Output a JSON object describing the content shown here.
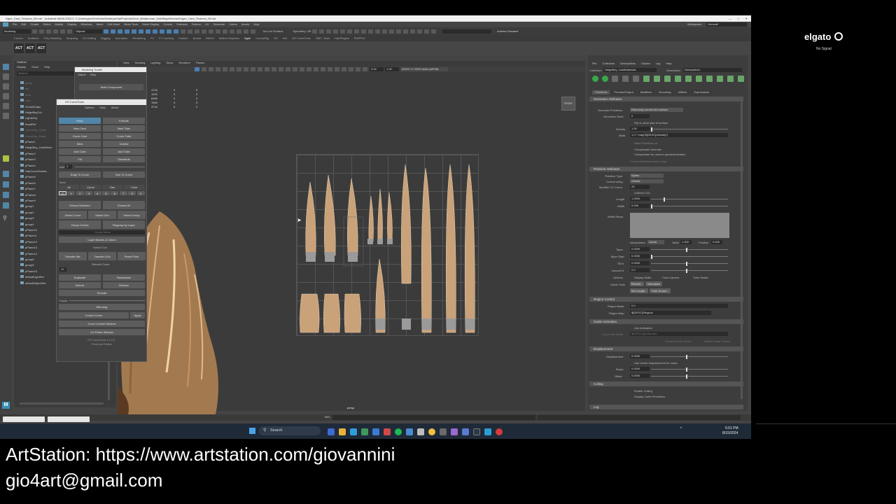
{
  "window": {
    "title": "Xgen_Card_Textures_05.ma* - Autodesk MAYA 2024.2: C:\\Users\\gior\\OneDrive\\Desktop\\HairProjects\\Zone_Metahuman_Hair\\Maya\\Scenes\\Xgen_Card_Textures_05.ma",
    "workspace_label": "Workspace:",
    "workspace_value": "General*"
  },
  "menubar": [
    "File",
    "Edit",
    "Create",
    "Select",
    "Modify",
    "Display",
    "Windows",
    "Mesh",
    "Edit Mesh",
    "Mesh Tools",
    "Mesh Display",
    "Curves",
    "Surfaces",
    "Deform",
    "UV",
    "Generate",
    "Cache",
    "Arnold",
    "Help"
  ],
  "statusline": {
    "mode": "Modeling",
    "objects": "Objects",
    "live_surface": "No Live Surface",
    "symmetry": "Symmetry: Off",
    "user": "Andrew Giovanni"
  },
  "shelf_tabs": [
    "Curves",
    "Surfaces",
    "Poly Modeling",
    "Sculpting",
    "UV Editing",
    "Rigging",
    "Animation",
    "Rendering",
    "FX",
    "FX Caching",
    "Custom",
    "Arnold",
    "MASH",
    "Motion Graphics",
    "Xgen",
    "CurveyRig",
    "GS",
    "Hot",
    "GS CurveTools",
    "GMT_Tools",
    "HairPlugins",
    "PURPLE"
  ],
  "outliner": {
    "title": "Outliner",
    "menu": [
      "Display",
      "Show",
      "Help"
    ],
    "search": "Search...",
    "items": [
      "persp",
      "top",
      "front",
      "side",
      "GrowthCaps",
      "HelgeBeyCut",
      "LightsGrp",
      "headRef",
      "CurveGrp_Guide",
      "CurveGrp_Scalp",
      "pPlane1",
      "HelgeBey_CardMesh",
      "pPlane2",
      "pPlane3",
      "pPlane4",
      "HairCurveGuides",
      "pPlane5",
      "pPlane6",
      "pPlane7",
      "pPlane8",
      "pPlane9",
      "group1",
      "group2",
      "group3",
      "group4",
      "pPlane10",
      "pPlane11",
      "pPlane12",
      "pPlane13",
      "pPlane14",
      "group5",
      "group6",
      "pPlane15",
      "defaultLightSet",
      "defaultObjectSet"
    ]
  },
  "modeling_toolkit": {
    "title": "Modeling Toolkit",
    "menu": [
      "Object",
      "Help"
    ],
    "multi_component": "Multi-Component",
    "stats": [
      [
        "4716",
        "0",
        "0"
      ],
      [
        "1193",
        "0",
        "0"
      ],
      [
        "6490",
        "0",
        "0"
      ],
      [
        "7840",
        "0",
        "0"
      ],
      [
        "4716",
        "0",
        "0"
      ]
    ]
  },
  "gs_curvetools": {
    "title": "GS CurveTools",
    "menu": [
      "Options",
      "Help",
      "About"
    ],
    "buttons": [
      [
        "Warp",
        "Extrude"
      ],
      [
        "New Card",
        "New Tube"
      ],
      [
        "Curve Card",
        "Curve Tube"
      ],
      [
        "Bind",
        "Unbind"
      ],
      [
        "Add Card",
        "Add Tube"
      ],
      [
        "Fill",
        "Subdivide"
      ]
    ],
    "add_label": "Add",
    "add_value": "3",
    "edge_to_curve": "Edge To Curve",
    "geo_to_curve": "Geo To Curve",
    "more": "More",
    "filters": [
      "All",
      "Curve",
      "Geo",
      "Color"
    ],
    "digits": [
      "0",
      "1",
      "2",
      "3",
      "4",
      "5",
      "6",
      "7",
      "8",
      "9"
    ],
    "extract_selected": "Extract Selected",
    "extract_all": "Extract All",
    "select_curve": "Select Curve",
    "select_geo": "Select Geo",
    "select_group": "Select Group",
    "group_curves": "Group Curves",
    "regroup_by_layer": "Regroup by Layer",
    "group_name": "Group Name",
    "layer_names_colors": "Layer Names & Colors",
    "select_cvs": "Select CVs",
    "transfer_attr": "Transfer Attr.",
    "transfer_uvs": "Transfer UVs",
    "reset_pivot": "Reset Pivot",
    "rebuild_curve": "Rebuild Curve",
    "rebuild_value": "10",
    "duplicate": "Duplicate",
    "randomize": "Randomize",
    "extend": "Extend",
    "reduce": "Reduce",
    "smooth": "Smooth",
    "factor": "Factor",
    "mirroring": "Mirroring",
    "control_curve": "Control Curve",
    "apply": "Apply",
    "curve_control_window": "Curve Control Window",
    "uv_editor_window": "UV Editor Window",
    "version": "GS CurveTools v1.3.4",
    "edition": "Personal Edition"
  },
  "viewport": {
    "menu": [
      "View",
      "Shading",
      "Lighting",
      "Show",
      "Renderer",
      "Panels"
    ],
    "values": [
      "0.00",
      "1.00"
    ],
    "colorspace": "ACES 1.0 SDR-video (sRGB)",
    "camera": "persp",
    "front_label": "FRONT"
  },
  "xgen": {
    "menu": [
      "File",
      "Collection",
      "Descriptions",
      "Guides",
      "Log",
      "Help"
    ],
    "collection_label": "Collection",
    "collection_value": "HelgeBey_CardMaterials",
    "description_label": "Description",
    "description_value": "Description1",
    "tabs": [
      "Primitives",
      "Preview/Output",
      "Modifiers",
      "Grooming",
      "Utilities",
      "Expressions"
    ],
    "sections": {
      "generator": "Generator Attributes",
      "primitive": "Primitive Attributes",
      "region": "Region Control",
      "animation": "Guide Animation",
      "displacement": "Displacement",
      "culling": "Culling",
      "log": "Log"
    },
    "generate_primitives_label": "Generate Primitives",
    "generate_primitives_value": "Randomly across the surface",
    "generator_seed_label": "Generator Seed",
    "generator_seed_value": "0",
    "flip_label": "Flip to other side of surface",
    "density_label": "Density",
    "density_value": "1.00",
    "mask_label": "Mask",
    "mask_value": "1.0 * map('${DESC}/density/')",
    "make_primitives": "Make Primitives at",
    "compensate_normals": "Compensate Normals",
    "compensate_uneven": "Compensate for uneven parameterization",
    "create_mask_map": "Create Mask/Modulation Map",
    "primitive_type_label": "Primitive Type",
    "primitive_type_value": "Spline",
    "control_using_label": "Control using",
    "control_using_value": "Guides",
    "modifier_cv_label": "Modifier CV Count",
    "modifier_cv_value": "25",
    "uniform_cvs": "Uniform CVs",
    "length_label": "Length",
    "length_value": "1.0000",
    "width_label": "Width",
    "width_value": "0.005",
    "width_ramp_label": "Width Ramp",
    "interpolation_label": "Interpolation",
    "interpolation_value": "Linear",
    "value_label": "Value",
    "value_value": "1.000",
    "position_label": "Position",
    "position_value": "0.000",
    "taper_label": "Taper",
    "taper_value": "0.0000",
    "taper_start_label": "Taper Start",
    "taper_start_value": "0.0000",
    "tilt_label": "Tilt N",
    "tilt_value": "0.0000",
    "around_label": "Around N",
    "around_value": "0.0",
    "options_label": "Options",
    "display_width": "Display Width",
    "face_camera": "Face Camera",
    "tube_shade": "Tube Shade",
    "guide_tools_label": "Guide Tools",
    "rebuild": "Rebuild...",
    "normalize": "Normalize",
    "set_length": "Set Length...",
    "tube_groom": "Tube Groom...",
    "region_mask_label": "Region Mask",
    "region_mask_value": "0.0",
    "region_map_label": "Region Map",
    "region_map_value": "${DESC}/Region/",
    "use_animation": "Use Animation",
    "curve_file_label": "Curve File Name",
    "curve_file_value": "${DESC}/guides.abc",
    "create_guide_curves": "Create Guide Curves",
    "attach_guide": "Attach Guide Curves",
    "disp_label": "Displacement",
    "disp_value": "0.0000",
    "use_vector": "Use Vector Displacement for maps",
    "bump_label": "Bump",
    "bump_value": "0.0000",
    "offset_label": "Offset",
    "offset_value": "0.0000",
    "enable_culling": "Enable Culling",
    "display_culled": "Display Culled Primitives"
  },
  "cmdline": {
    "mel": "MEL"
  },
  "taskbar": {
    "search": "Search",
    "time": "5:51 PM",
    "date": "8/15/2024"
  },
  "elgato": {
    "brand": "elgato",
    "status": "No Signal"
  },
  "overlay": {
    "line1": "ArtStation: https://www.artstation.com/giovannini",
    "line2": "gio4art@gmail.com"
  },
  "colors": {
    "maya_bg": "#444444",
    "viewport_bg": "#3b3b3b",
    "accent_blue": "#5285a6",
    "hair": "#c9a27a"
  }
}
